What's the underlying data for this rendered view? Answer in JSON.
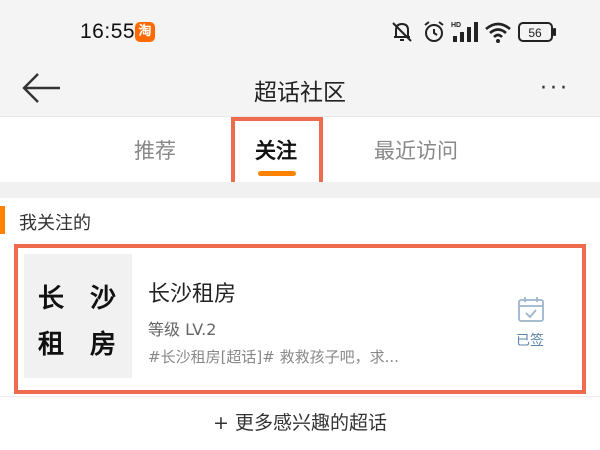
{
  "status_bar": {
    "time": "16:55",
    "app_badge": "淘",
    "battery": "56",
    "network": "HD",
    "icons": [
      "mute-icon",
      "alarm-icon",
      "signal-icon",
      "wifi-icon",
      "battery-icon"
    ]
  },
  "nav": {
    "title": "超话社区",
    "more_label": "···",
    "icons": [
      "back-arrow-icon",
      "more-icon"
    ]
  },
  "tabs": [
    {
      "label": "推荐",
      "active": false
    },
    {
      "label": "关注",
      "active": true
    },
    {
      "label": "最近访问",
      "active": false
    }
  ],
  "section": {
    "title": "我关注的"
  },
  "card": {
    "thumb_chars": [
      "长",
      "沙",
      "租",
      "房"
    ],
    "name": "长沙租房",
    "level": "等级 LV.2",
    "desc": "#长沙租房[超话]#  救救孩子吧，求...",
    "status_label": "已签",
    "status_icon": "calendar-check-icon"
  },
  "footer": {
    "more_label": "+ 更多感兴趣的超话"
  },
  "colors": {
    "accent": "#ff8200",
    "highlight_box": "#ee6c4d",
    "signed_blue": "#5d84a8",
    "taobao_orange": "#ff6a00"
  }
}
